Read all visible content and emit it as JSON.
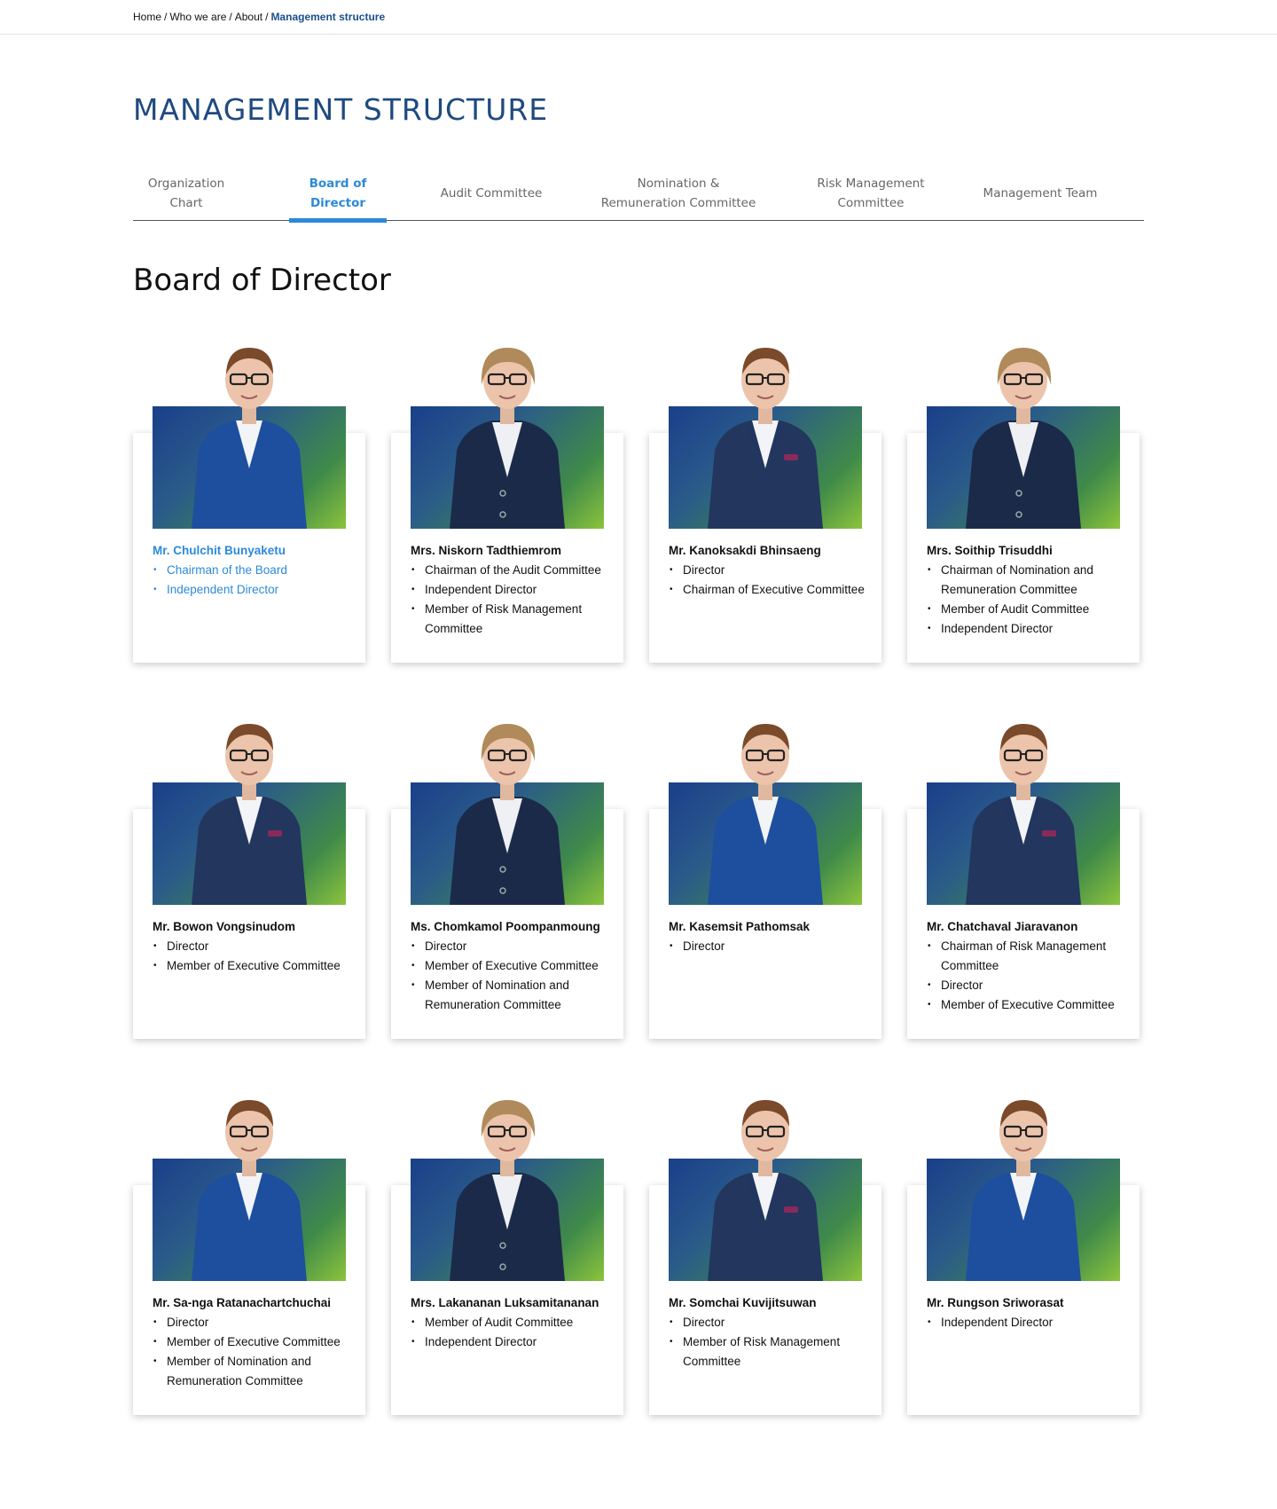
{
  "breadcrumb": {
    "home": "Home",
    "who_we_are": "Who we are",
    "about": "About",
    "current": "Management structure"
  },
  "page_title": "MANAGEMENT STRUCTURE",
  "tabs": [
    {
      "label": "Organization Chart"
    },
    {
      "label": "Board of Director"
    },
    {
      "label": "Audit Committee"
    },
    {
      "label": "Nomination &\nRemuneration Committee"
    },
    {
      "label": "Risk Management\nCommittee"
    },
    {
      "label": "Management Team"
    }
  ],
  "active_tab": "Board of Director",
  "section_title": "Board of Director",
  "colors": {
    "accent_blue": "#2c8ad9",
    "title_navy": "#1e4a80",
    "photo_gradient_start": "#1a3f8a",
    "photo_gradient_end": "#8cc43c"
  },
  "directors": [
    {
      "name": "Mr. Chulchit Bunyaketu",
      "roles": [
        "Chairman of the Board",
        "Independent Director"
      ],
      "portrait": "man-blue-suit",
      "highlighted": true
    },
    {
      "name": "Mrs. Niskorn Tadthiemrom",
      "roles": [
        "Chairman of the Audit Committee",
        "Independent Director",
        "Member of Risk Management Committee"
      ],
      "portrait": "woman-dark-blazer"
    },
    {
      "name": "Mr. Kanoksakdi Bhinsaeng",
      "roles": [
        "Director",
        "Chairman of Executive Committee"
      ],
      "portrait": "man-navy-suit"
    },
    {
      "name": "Mrs. Soithip Trisuddhi",
      "roles": [
        "Chairman of Nomination and Remuneration Committee",
        "Member of Audit Committee",
        "Independent Director"
      ],
      "portrait": "woman-dark-blazer"
    },
    {
      "name": "Mr. Bowon Vongsinudom",
      "roles": [
        "Director",
        "Member of Executive Committee"
      ],
      "portrait": "man-navy-suit"
    },
    {
      "name": "Ms. Chomkamol Poompanmoung",
      "roles": [
        "Director",
        "Member of Executive Committee",
        "Member of Nomination and Remuneration Committee"
      ],
      "portrait": "woman-dark-blazer"
    },
    {
      "name": "Mr. Kasemsit Pathomsak",
      "roles": [
        "Director"
      ],
      "portrait": "man-blue-suit"
    },
    {
      "name": "Mr. Chatchaval Jiaravanon",
      "roles": [
        "Chairman of Risk Management Committee",
        "Director",
        "Member of Executive Committee"
      ],
      "portrait": "man-navy-suit"
    },
    {
      "name": "Mr. Sa-nga Ratanachartchuchai",
      "roles": [
        "Director",
        "Member of Executive Committee",
        "Member of Nomination and Remuneration Committee"
      ],
      "portrait": "man-blue-suit"
    },
    {
      "name": "Mrs. Lakananan Luksamitananan",
      "roles": [
        "Member of Audit Committee",
        "Independent Director"
      ],
      "portrait": "woman-dark-blazer"
    },
    {
      "name": "Mr. Somchai Kuvijitsuwan",
      "roles": [
        "Director",
        "Member of Risk Management Committee"
      ],
      "portrait": "man-navy-suit"
    },
    {
      "name": "Mr. Rungson Sriworasat",
      "roles": [
        "Independent Director"
      ],
      "portrait": "man-blue-suit"
    }
  ]
}
